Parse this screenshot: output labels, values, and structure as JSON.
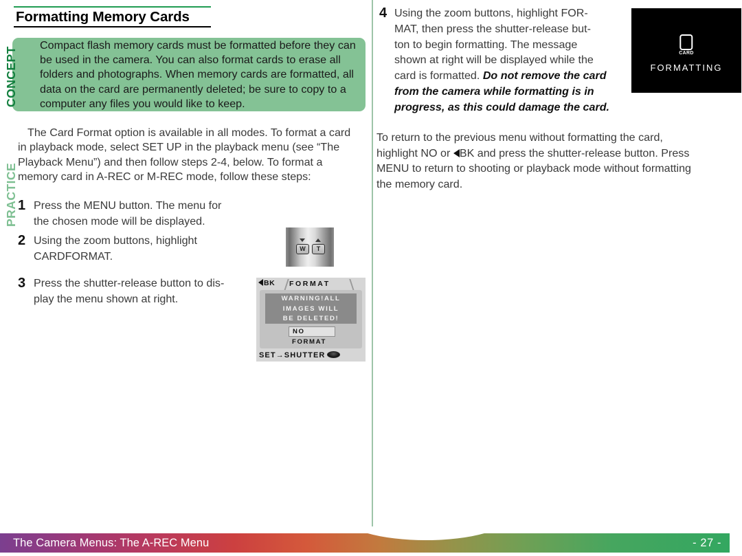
{
  "page": {
    "title": "Formatting Memory Cards"
  },
  "sidebar_tags": {
    "concept": "CONCEPT",
    "practice": "PRACTICE"
  },
  "concept": {
    "lines": [
      "Compact flash memory cards must be formatted before they can",
      "be used in the camera.  You can also format cards to erase all",
      "folders and photographs.  When memory cards are formatted, all",
      "data on the card are permanently deleted; be sure to copy to a",
      "computer any files you would like to keep."
    ],
    "background_color": "#84c295"
  },
  "practice": {
    "intro_lines": [
      "The Card Format option is available in all  modes.  To format a card",
      "in playback mode, select SET UP in the playback menu (see “The",
      "Playback Menu”) and then follow steps 2-4, below.  To format a",
      "memory card in A-REC or M-REC mode, follow these steps:"
    ],
    "steps": [
      {
        "number": "1",
        "lines": [
          "Press the MENU button.  The menu for",
          "the chosen mode will be displayed."
        ]
      },
      {
        "number": "2",
        "lines": [
          "Using  the  zoom  buttons,  highlight",
          "CARDFORMAT."
        ]
      },
      {
        "number": "3",
        "lines": [
          "Press the shutter-release button to dis-",
          "play the menu shown at right."
        ]
      }
    ]
  },
  "zoom_photo": {
    "wide_label": "W",
    "tele_label": "T"
  },
  "lcd_format_menu": {
    "back_label": "BK",
    "tab_title": "FORMAT",
    "warning_lines": [
      "WARNING!ALL",
      "IMAGES WILL",
      "BE DELETED!"
    ],
    "choice_selected": "NO",
    "choice_other": "FORMAT",
    "footer": "SET→SHUTTER"
  },
  "lcd_formatting_screen": {
    "card_icon_label": "CARD",
    "status_text": "FORMATTING",
    "background_color": "#000000"
  },
  "step4": {
    "number": "4",
    "lines": [
      {
        "text": "Using the zoom buttons, highlight FOR-",
        "bold_italic": false
      },
      {
        "text": "MAT, then press the shutter-release but-",
        "bold_italic": false
      },
      {
        "text": "ton  to  begin  formatting.   The  message",
        "bold_italic": false
      },
      {
        "text": "shown at right will be displayed while the",
        "bold_italic": false
      },
      {
        "text": "card is formatted. ",
        "bold_italic": false,
        "tail": "Do not remove the card"
      },
      {
        "text": "from  the  camera  while  formatting  is  in",
        "bold_italic": true
      },
      {
        "text": "progress, as this could damage the card.",
        "bold_italic": true
      }
    ]
  },
  "right_paragraph": {
    "lines": [
      "To  return  to  the  previous  menu  without  formatting  the  card,",
      "highlight NO or ",
      "BK and press the shutter-release button.  Press",
      "MENU to return to shooting or playback mode without formatting",
      "the memory card."
    ]
  },
  "footer": {
    "title": "The Camera Menus: The A-REC Menu",
    "page_number": "- 27 -",
    "gradient_colors": [
      "#7b3f8f",
      "#cc4040",
      "#c27a3e",
      "#33a760"
    ]
  }
}
